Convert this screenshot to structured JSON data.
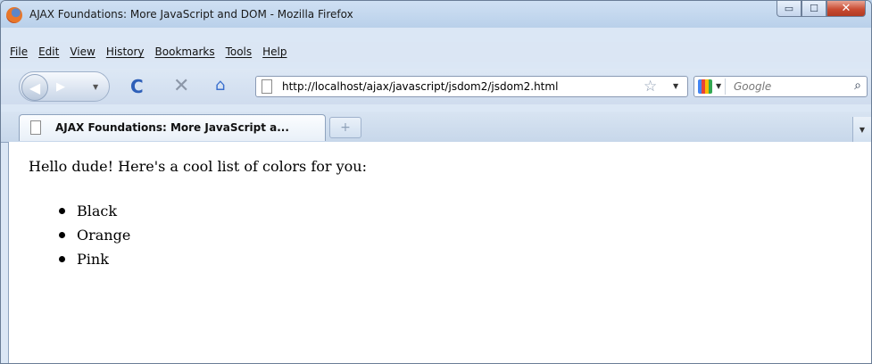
{
  "window": {
    "title": "AJAX Foundations: More JavaScript and DOM - Mozilla Firefox",
    "min_glyph": "▭",
    "max_glyph": "☐",
    "close_glyph": "✕"
  },
  "menu": {
    "items": [
      {
        "label": "File"
      },
      {
        "label": "Edit"
      },
      {
        "label": "View"
      },
      {
        "label": "History"
      },
      {
        "label": "Bookmarks"
      },
      {
        "label": "Tools"
      },
      {
        "label": "Help"
      }
    ]
  },
  "navigation": {
    "url": "http://localhost/ajax/javascript/jsdom2/jsdom2.html",
    "search_placeholder": "Google",
    "back_glyph": "◀",
    "forward_glyph": "▶",
    "reload_glyph": "C",
    "stop_glyph": "✕",
    "home_glyph": "⌂",
    "star_glyph": "☆",
    "dropdown_glyph": "▼",
    "search_glyph": "⌕"
  },
  "tabs": {
    "active_label": "AJAX Foundations: More JavaScript a...",
    "newtab_glyph": "+",
    "menu_glyph": "▼"
  },
  "page": {
    "intro": "Hello dude! Here's a cool list of colors for you:",
    "colors": [
      "Black",
      "Orange",
      "Pink"
    ]
  }
}
